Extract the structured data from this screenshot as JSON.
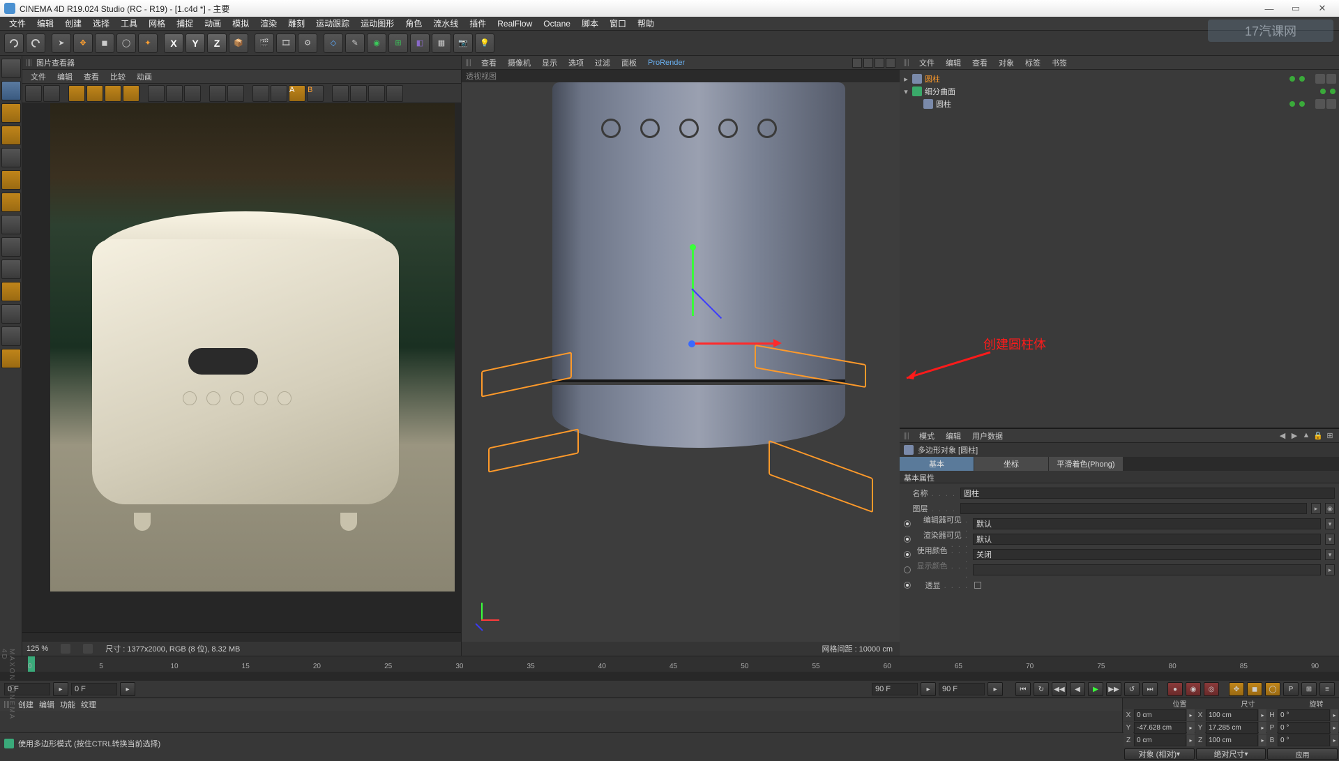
{
  "title": "CINEMA 4D R19.024 Studio (RC - R19) - [1.c4d *] - 主要",
  "menubar": [
    "文件",
    "编辑",
    "创建",
    "选择",
    "工具",
    "网格",
    "捕捉",
    "动画",
    "模拟",
    "渲染",
    "雕刻",
    "运动跟踪",
    "运动图形",
    "角色",
    "流水线",
    "插件",
    "RealFlow",
    "Octane",
    "脚本",
    "窗口",
    "帮助"
  ],
  "axes": [
    "X",
    "Y",
    "Z"
  ],
  "img_panel_title": "图片查看器",
  "img_menu": [
    "文件",
    "编辑",
    "查看",
    "比较",
    "动画"
  ],
  "img_zoom": "125 %",
  "img_info": "尺寸 : 1377x2000, RGB (8 位), 8.32 MB",
  "vp_menu": [
    "查看",
    "摄像机",
    "显示",
    "选项",
    "过滤",
    "面板"
  ],
  "vp_prorender": "ProRender",
  "vp_tab": "透视视图",
  "vp_grid": "网格间距 : 10000 cm",
  "obj_menu": [
    "文件",
    "编辑",
    "查看",
    "对象",
    "标签",
    "书签"
  ],
  "obj_tree": [
    {
      "name": "圆柱",
      "icon": "cyl",
      "indent": 0,
      "exp": "▸",
      "sel": true
    },
    {
      "name": "细分曲面",
      "icon": "sds",
      "indent": 0,
      "exp": "▾",
      "sel": false
    },
    {
      "name": "圆柱",
      "icon": "cyl",
      "indent": 1,
      "exp": "",
      "sel": false
    }
  ],
  "annotation": "创建圆柱体",
  "attr_menu": [
    "模式",
    "编辑",
    "用户数据"
  ],
  "attr_head": "多边形对象 [圆柱]",
  "attr_tabs": [
    "基本",
    "坐标",
    "平滑着色(Phong)"
  ],
  "attr_section": "基本属性",
  "attr_rows": {
    "name_lbl": "名称",
    "name_val": "圆柱",
    "layer_lbl": "图层",
    "edvis_lbl": "编辑器可见",
    "edvis_val": "默认",
    "rnvis_lbl": "渲染器可见",
    "rnvis_val": "默认",
    "usecol_lbl": "使用颜色",
    "usecol_val": "关闭",
    "showcol_lbl": "显示颜色",
    "xray_lbl": "透显"
  },
  "timeline": {
    "start": "0 F",
    "end": "90 F",
    "cur": "0 F",
    "end2": "90 F",
    "ticks": [
      "0",
      "5",
      "10",
      "15",
      "20",
      "25",
      "30",
      "35",
      "40",
      "45",
      "50",
      "55",
      "60",
      "65",
      "70",
      "75",
      "80",
      "85",
      "90"
    ]
  },
  "mat_menu": [
    "创建",
    "编辑",
    "功能",
    "纹理"
  ],
  "coord_head": [
    "位置",
    "尺寸",
    "旋转"
  ],
  "coord": {
    "x": {
      "p": "0 cm",
      "s": "100 cm",
      "r": "0 °",
      "rl": "H"
    },
    "y": {
      "p": "-47.628 cm",
      "s": "17.285 cm",
      "r": "0 °",
      "rl": "P"
    },
    "z": {
      "p": "0 cm",
      "s": "100 cm",
      "r": "0 °",
      "rl": "B"
    }
  },
  "coord_btns": [
    "对象 (相对)",
    "绝对尺寸",
    "应用"
  ],
  "status": "使用多边形模式 (按住CTRL转换当前选择)",
  "maxon": "MAXON CINEMA 4D",
  "watermark": "17汽课网"
}
